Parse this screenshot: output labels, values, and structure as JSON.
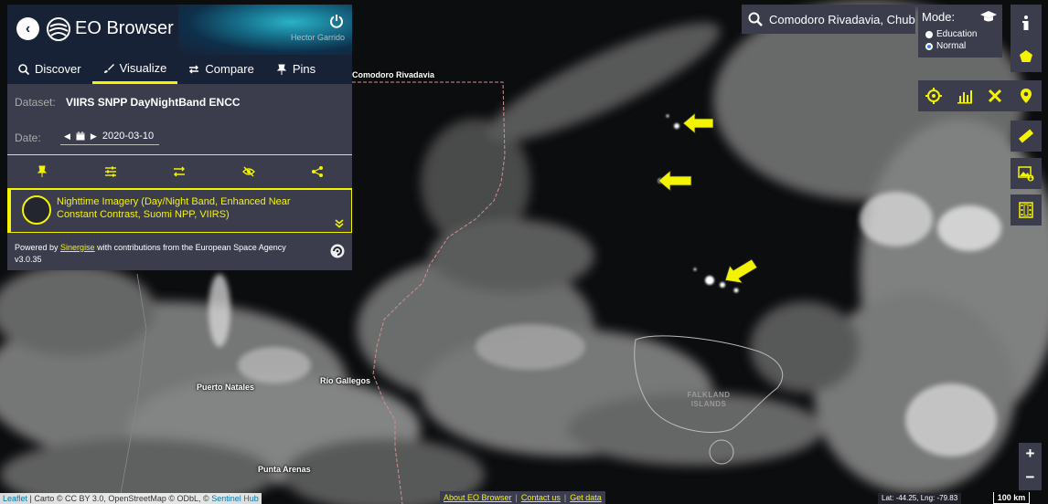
{
  "app": {
    "brand": "EO Browser",
    "user": "Hector Garrido"
  },
  "tabs": [
    {
      "label": "Discover",
      "icon": "search-icon"
    },
    {
      "label": "Visualize",
      "icon": "brush-icon",
      "active": true
    },
    {
      "label": "Compare",
      "icon": "compare-arrows-icon"
    },
    {
      "label": "Pins",
      "icon": "pin-icon"
    }
  ],
  "visualize": {
    "dataset_label": "Dataset:",
    "dataset_value": "VIIRS SNPP DayNightBand ENCC",
    "date_label": "Date:",
    "date_value": "2020-03-10",
    "layer_title": "Nighttime Imagery (Day/Night Band, Enhanced Near Constant Contrast, Suomi NPP, VIIRS)"
  },
  "powered": {
    "prefix": "Powered by",
    "link": "Sinergise",
    "suffix": "with contributions from the European Space Agency",
    "version": "v3.0.35"
  },
  "search": {
    "value": "Comodoro Rivadavia, Chubut, Argentina"
  },
  "mode": {
    "title": "Mode:",
    "options": [
      "Education",
      "Normal"
    ],
    "selected": "Normal"
  },
  "map": {
    "labels": {
      "comodoro": "Comodoro Rivadavia",
      "puerto_natales": "Puerto Natales",
      "rio_gallegos": "Río Gallegos",
      "punta_arenas": "Punta Arenas",
      "falkland_line1": "FALKLAND",
      "falkland_line2": "ISLANDS"
    }
  },
  "footer": {
    "attr_leaflet": "Leaflet",
    "attr_text": "| Carto © CC BY 3.0, OpenStreetMap © ODbL, ©",
    "attr_hub": "Sentinel Hub",
    "links": [
      "About EO Browser",
      "Contact us",
      "Get data"
    ],
    "coords": "Lat: -44.25, Lng: -79.83",
    "scale": "100 km"
  },
  "colors": {
    "accent": "#f4f400",
    "panel": "#3b3d4d",
    "header": "#182236"
  }
}
